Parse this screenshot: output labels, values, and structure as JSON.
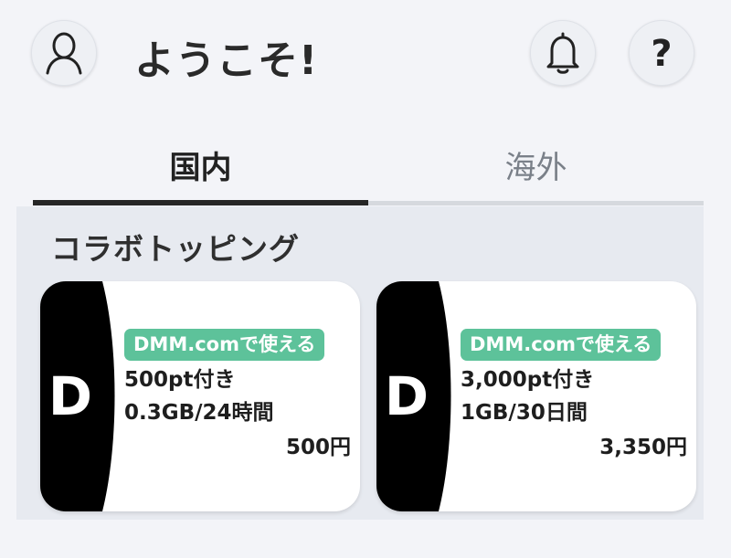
{
  "header": {
    "welcome": "ようこそ!",
    "avatar_icon": "user-icon",
    "bell_icon": "bell-icon",
    "help_icon": "question-icon",
    "help_glyph": "?"
  },
  "tabs": [
    {
      "label": "国内",
      "active": true
    },
    {
      "label": "海外",
      "active": false
    }
  ],
  "section": {
    "title": "コラボトッピング"
  },
  "cards": [
    {
      "logo_letter": "D",
      "badge": "DMM.comで使える",
      "line1": "500pt付き",
      "line2": "0.3GB/24時間",
      "price": "500円"
    },
    {
      "logo_letter": "D",
      "badge": "DMM.comで使える",
      "line1": "3,000pt付き",
      "line2": "1GB/30日間",
      "price": "3,350円"
    }
  ],
  "colors": {
    "background": "#f3f4f8",
    "badge": "#5dc29a",
    "tab_active": "#262626",
    "logo": "#000000"
  }
}
